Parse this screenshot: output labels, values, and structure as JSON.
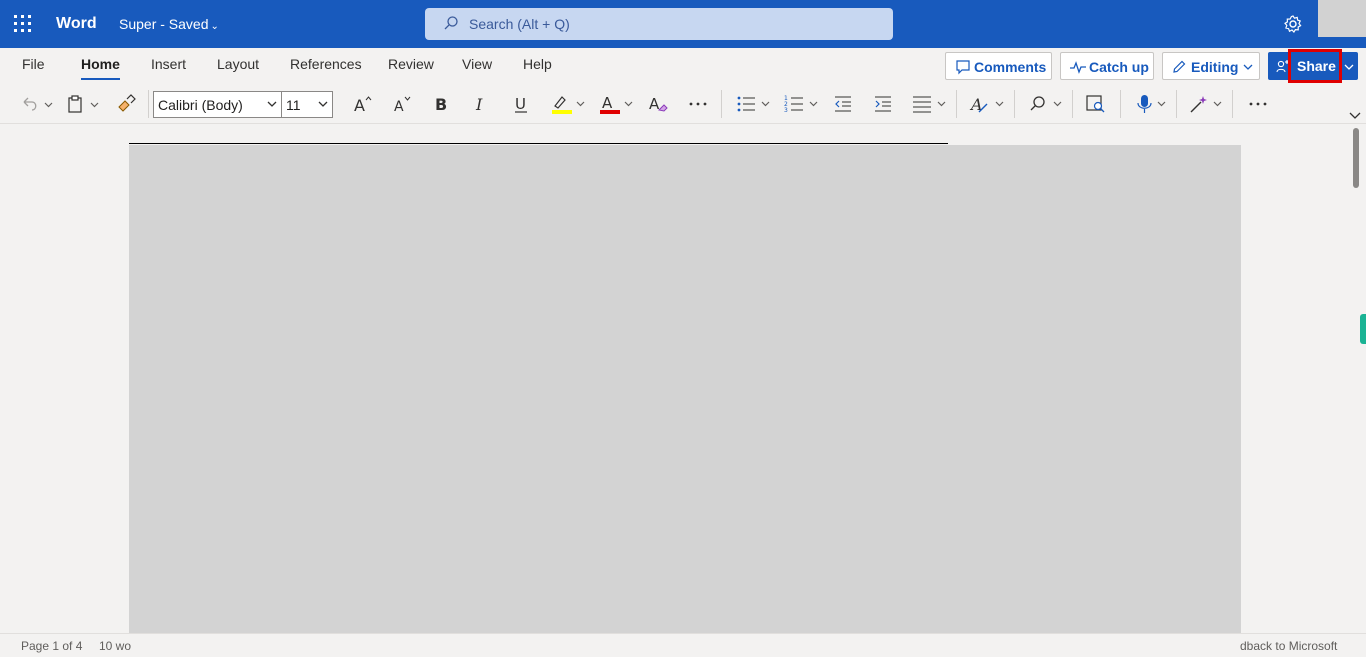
{
  "titlebar": {
    "app_name": "Word",
    "doc_name": "Super - Saved",
    "search_placeholder": "Search (Alt + Q)"
  },
  "tabs": [
    "File",
    "Home",
    "Insert",
    "Layout",
    "References",
    "Review",
    "View",
    "Help"
  ],
  "active_tab": "Home",
  "header_buttons": {
    "comments": "Comments",
    "catch_up": "Catch up",
    "editing": "Editing",
    "share": "Share"
  },
  "ribbon": {
    "font_name": "Calibri (Body)",
    "font_size": "11"
  },
  "status": {
    "page": "Page 1 of 4",
    "words": "10 wo",
    "feedback": "dback to Microsoft"
  },
  "colors": {
    "brand": "#185abd",
    "highlight": "#ffff00",
    "font_color": "#e00000",
    "annotation": "#e00000"
  }
}
